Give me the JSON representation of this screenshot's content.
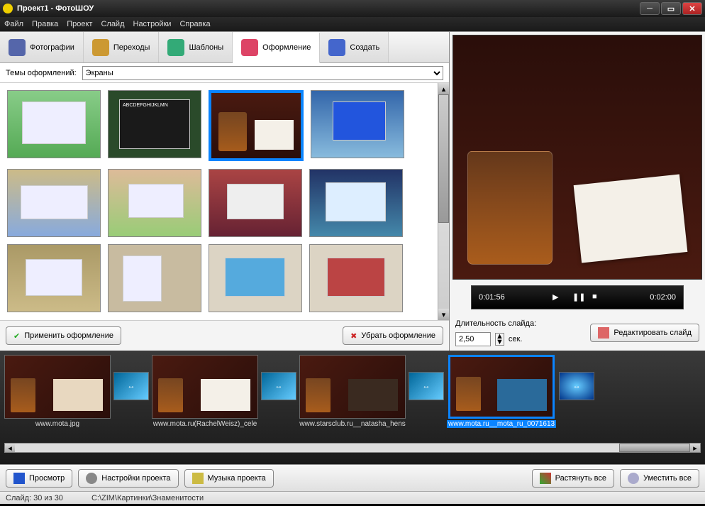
{
  "titlebar": {
    "title": "Проект1 - ФотоШОУ"
  },
  "menu": [
    "Файл",
    "Правка",
    "Проект",
    "Слайд",
    "Настройки",
    "Справка"
  ],
  "tabs": [
    {
      "label": "Фотографии",
      "icon": "#56a"
    },
    {
      "label": "Переходы",
      "icon": "#c93"
    },
    {
      "label": "Шаблоны",
      "icon": "#3a7"
    },
    {
      "label": "Оформление",
      "icon": "#d46",
      "active": true
    },
    {
      "label": "Создать",
      "icon": "#46c"
    }
  ],
  "theme_label": "Темы оформлений:",
  "theme_selected": "Экраны",
  "apply_btn": "Применить оформление",
  "remove_btn": "Убрать оформление",
  "player": {
    "current": "0:01:56",
    "total": "0:02:00"
  },
  "duration_label": "Длительность слайда:",
  "duration_value": "2,50",
  "duration_unit": "сек.",
  "edit_slide_btn": "Редактировать слайд",
  "timeline": [
    {
      "label": "www.mota.jpg"
    },
    {
      "label": "www.mota.ru(RachelWeisz)_cele"
    },
    {
      "label": "www.starsclub.ru__natasha_hens"
    },
    {
      "label": "www.mota.ru__mota_ru_0071613",
      "selected": true
    }
  ],
  "bottom": {
    "preview": "Просмотр",
    "settings": "Настройки проекта",
    "music": "Музыка проекта",
    "stretch": "Растянуть все",
    "fit": "Уместить все"
  },
  "status": {
    "slide": "Слайд: 30 из 30",
    "path": "C:\\ZIM\\Картинки\\Знаменитости"
  }
}
